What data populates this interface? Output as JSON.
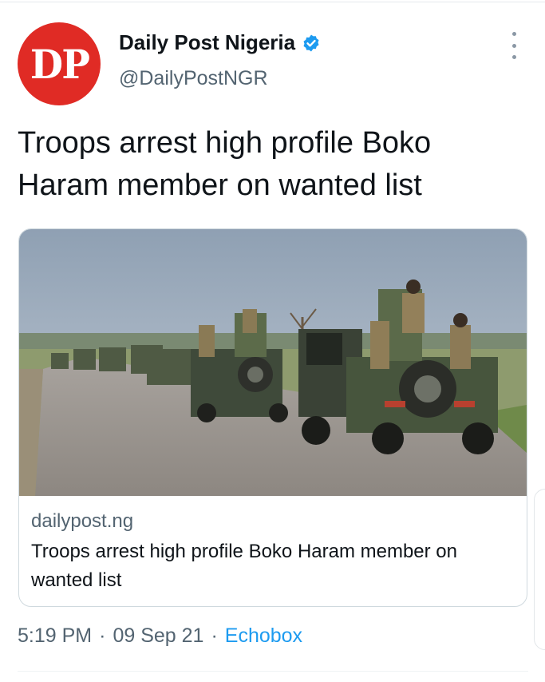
{
  "author": {
    "avatar_text": "DP",
    "display_name": "Daily Post Nigeria",
    "handle": "@DailyPostNGR",
    "verified": true
  },
  "tweet": {
    "text": "Troops arrest high profile Boko Haram member on wanted list"
  },
  "card": {
    "domain": "dailypost.ng",
    "title": "Troops arrest high profile Boko Haram member on wanted list",
    "image_description": "military convoy"
  },
  "meta": {
    "time": "5:19 PM",
    "separator": "·",
    "date": "09 Sep 21",
    "source": "Echobox"
  },
  "colors": {
    "brand_red": "#e02b25",
    "link_blue": "#1d9bf0",
    "secondary_text": "#536471"
  },
  "icons": {
    "verified": "verified-badge-icon",
    "more": "more-options-icon"
  }
}
